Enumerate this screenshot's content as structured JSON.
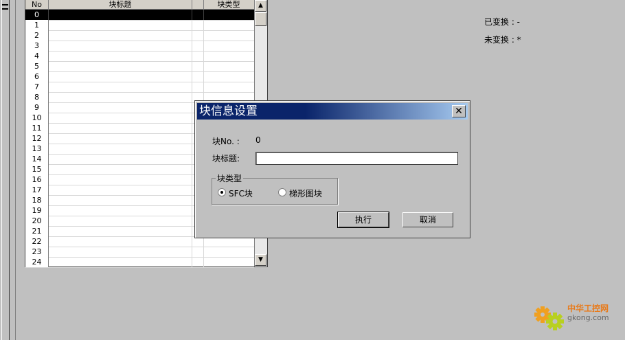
{
  "table": {
    "headers": {
      "no": "No",
      "title": "块标题",
      "type": "块类型"
    },
    "rows": [
      "0",
      "1",
      "2",
      "3",
      "4",
      "5",
      "6",
      "7",
      "8",
      "9",
      "10",
      "11",
      "12",
      "13",
      "14",
      "15",
      "16",
      "17",
      "18",
      "19",
      "20",
      "21",
      "22",
      "23",
      "24"
    ],
    "selected_row": "0"
  },
  "status": {
    "converted": "已变换 : -",
    "unconverted": "未变换 : *"
  },
  "dialog": {
    "title": "块信息设置",
    "block_no_label": "块No. :",
    "block_no_value": "0",
    "block_title_label": "块标题:",
    "block_title_value": "",
    "block_type_group": "块类型",
    "radio_sfc": "SFC块",
    "radio_ladder": "梯形图块",
    "selected_type": "SFC块",
    "execute_button": "执行",
    "cancel_button": "取消",
    "close_symbol": "✕"
  },
  "watermark": {
    "line1": "中华工控网",
    "line2": "gkong.com"
  },
  "colors": {
    "titlebar_start": "#0a246a",
    "titlebar_end": "#a6caf0",
    "background": "#c0c0c0"
  }
}
